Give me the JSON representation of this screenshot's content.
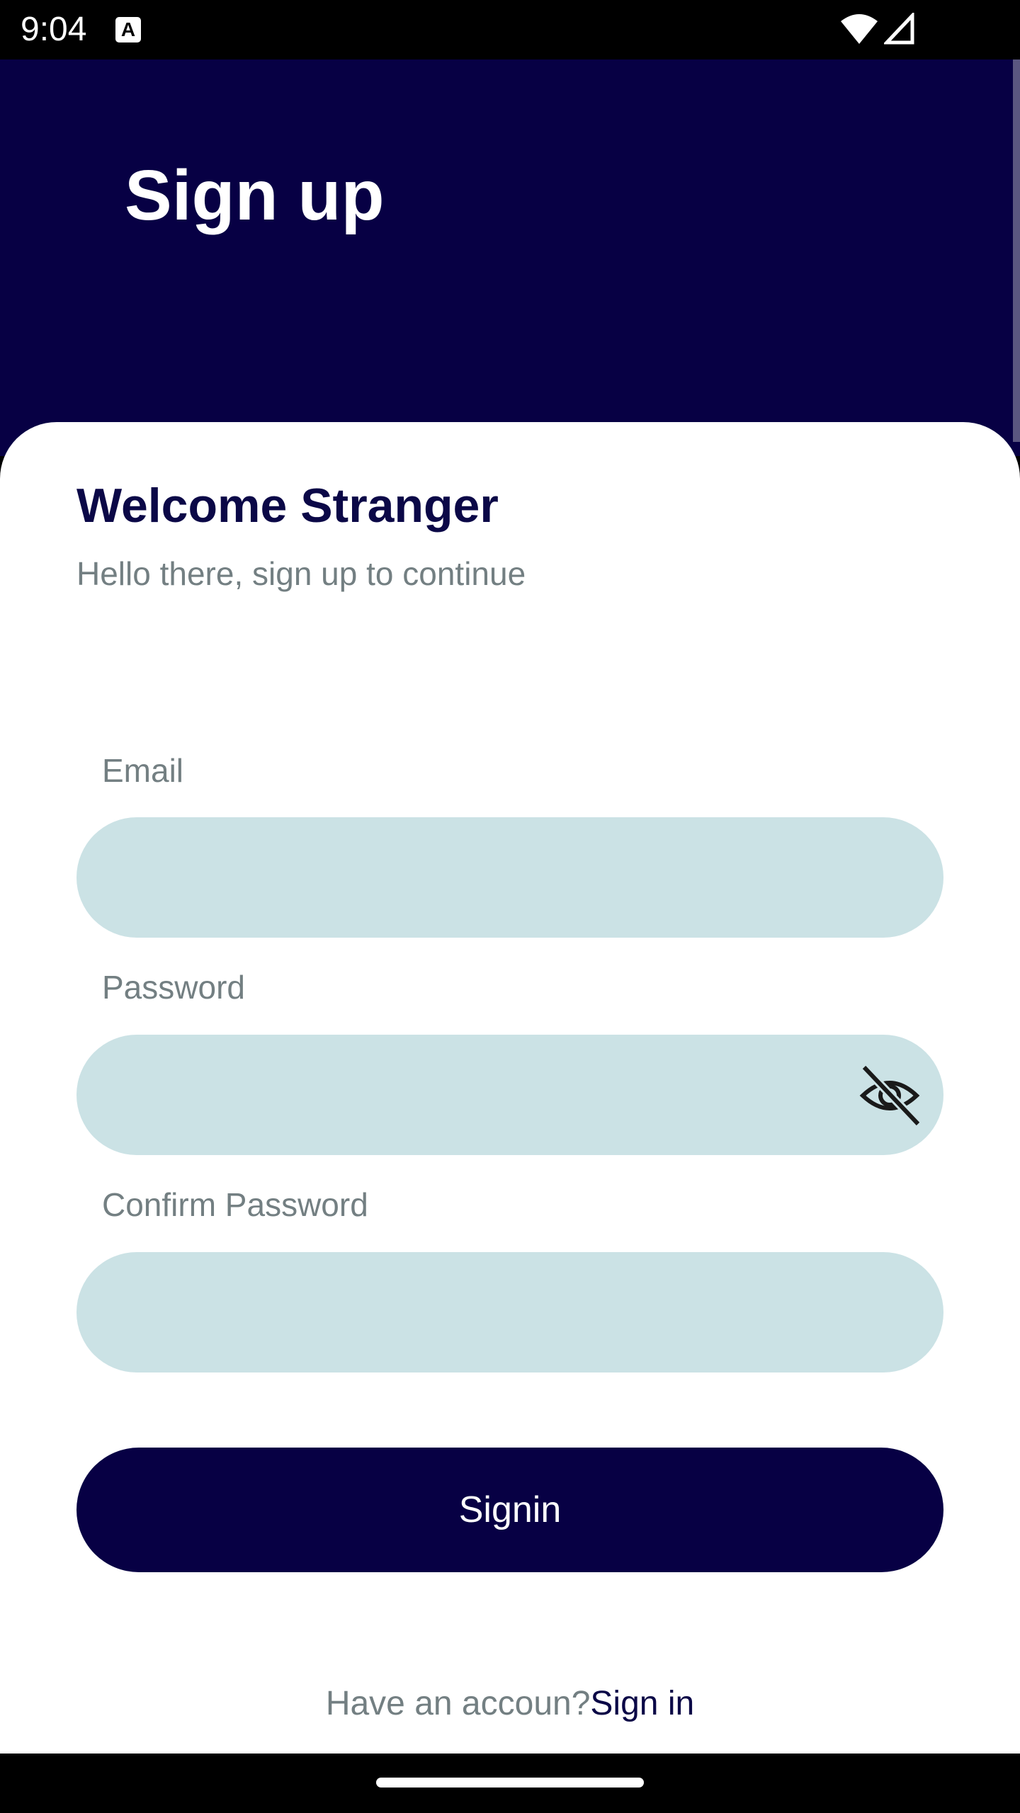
{
  "status_bar": {
    "time": "9:04",
    "notification_icon": "a-notification-icon",
    "wifi_icon": "wifi-icon",
    "signal_icon": "cell-signal-icon"
  },
  "header": {
    "title": "Sign up",
    "background": "#070044"
  },
  "card": {
    "title": "Welcome Stranger",
    "subtitle": "Hello there, sign up to continue"
  },
  "form": {
    "email_label": "Email",
    "email_value": "",
    "password_label": "Password",
    "password_value": "",
    "password_toggle_icon": "eye-off-icon",
    "confirm_label": "Confirm Password",
    "confirm_value": "",
    "field_color": "#cbe2e5"
  },
  "submit": {
    "label": "Signin",
    "color": "#070044"
  },
  "footer": {
    "prompt": "Have an accoun?",
    "link": "Sign in"
  }
}
